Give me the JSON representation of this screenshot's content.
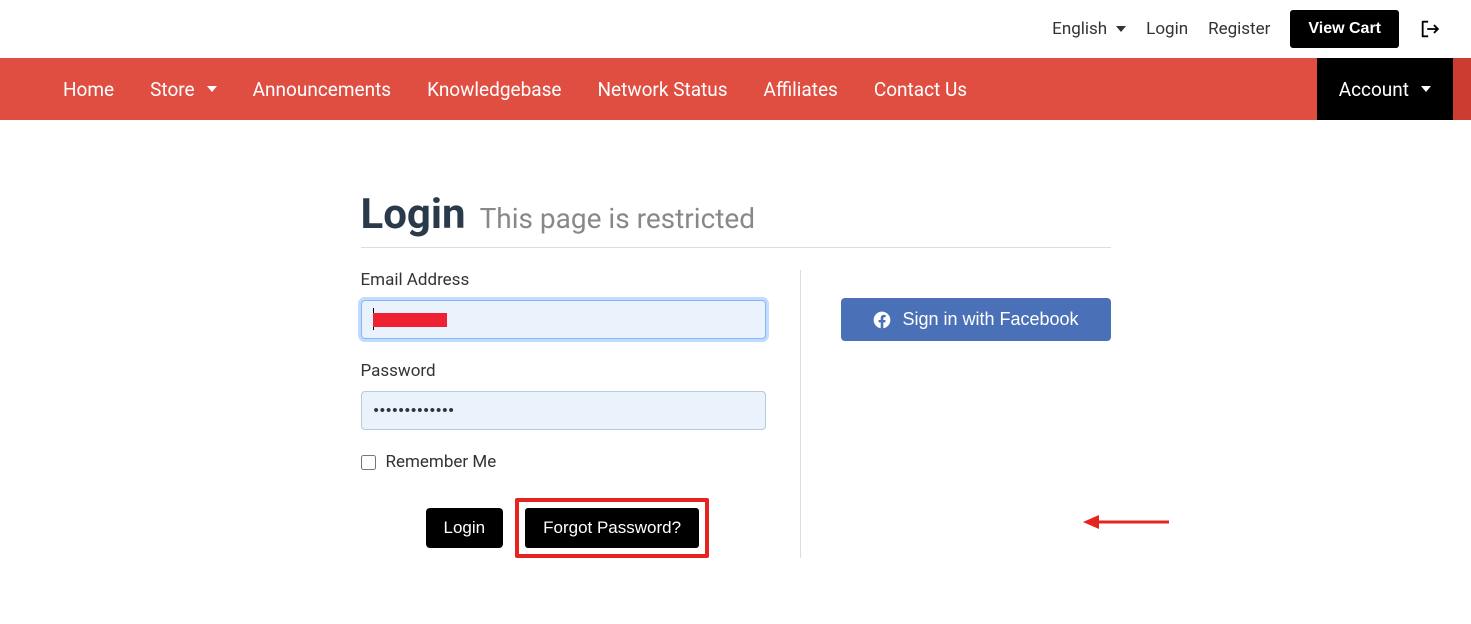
{
  "topbar": {
    "language": "English",
    "login": "Login",
    "register": "Register",
    "view_cart": "View Cart"
  },
  "nav": {
    "home": "Home",
    "store": "Store",
    "announcements": "Announcements",
    "knowledgebase": "Knowledgebase",
    "network_status": "Network Status",
    "affiliates": "Affiliates",
    "contact_us": "Contact Us",
    "account": "Account"
  },
  "page": {
    "title": "Login",
    "subtitle": "This page is restricted"
  },
  "form": {
    "email_label": "Email Address",
    "email_value": "",
    "password_label": "Password",
    "password_value": "•••••••••••••",
    "remember_label": "Remember Me",
    "login_btn": "Login",
    "forgot_btn": "Forgot Password?"
  },
  "social": {
    "facebook": "Sign in with Facebook"
  }
}
